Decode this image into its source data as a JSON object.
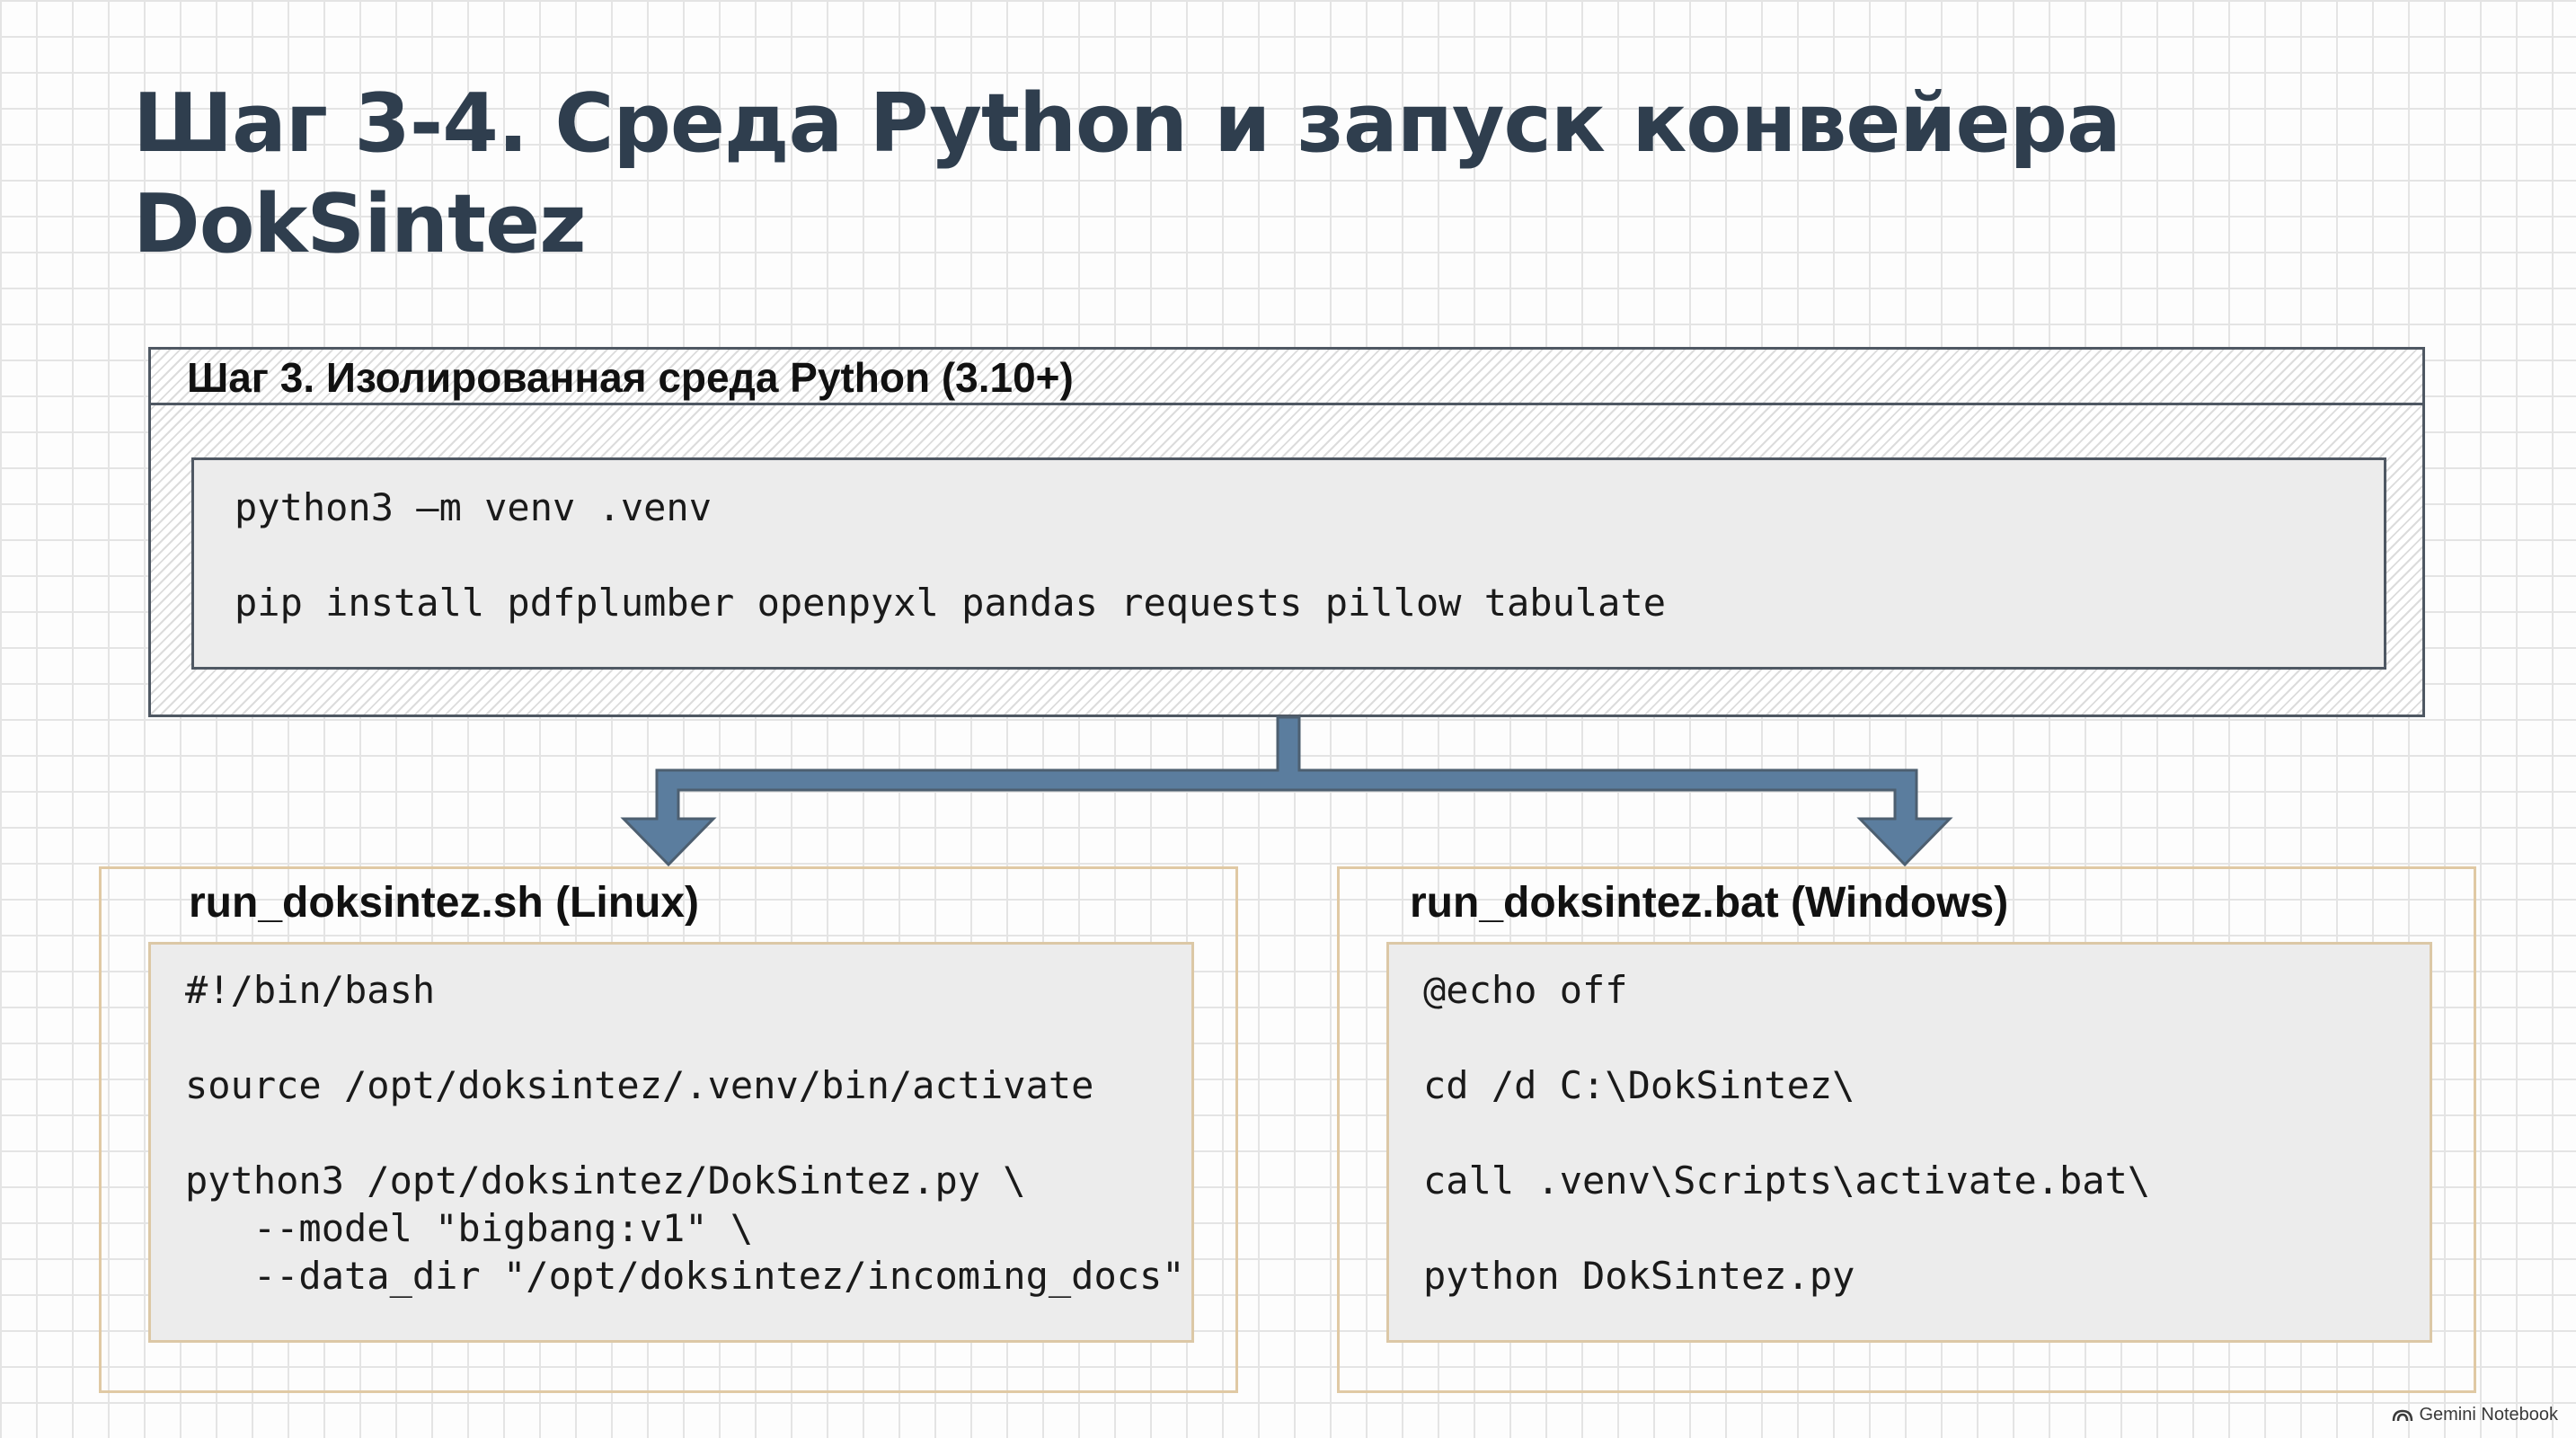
{
  "title_line1": "Шаг 3-4. Среда Python и запуск конвейера",
  "title_line2": "DokSintez",
  "step3": {
    "header": "Шаг 3. Изолированная среда Python (3.10+)",
    "lines": [
      "python3 –m venv .venv",
      "pip install pdfplumber openpyxl pandas requests pillow tabulate"
    ]
  },
  "linux": {
    "title": "run_doksintez.sh (Linux)",
    "lines": [
      "#!/bin/bash",
      "source /opt/doksintez/.venv/bin/activate",
      "python3 /opt/doksintez/DokSintez.py \\",
      "   --model \"bigbang:v1\" \\",
      "   --data_dir \"/opt/doksintez/incoming_docs\""
    ]
  },
  "windows": {
    "title": "run_doksintez.bat (Windows)",
    "lines": [
      "@echo off",
      "cd /d C:\\DokSintez\\",
      "call .venv\\Scripts\\activate.bat\\",
      "python DokSintez.py"
    ]
  },
  "watermark": "Gemini Notebook",
  "colors": {
    "title": "#2f3e4e",
    "arrow": "#5b7d9e",
    "arrow_outline": "#4d5f70",
    "frame_border": "#e0c9a4",
    "code_background": "#ececec"
  }
}
